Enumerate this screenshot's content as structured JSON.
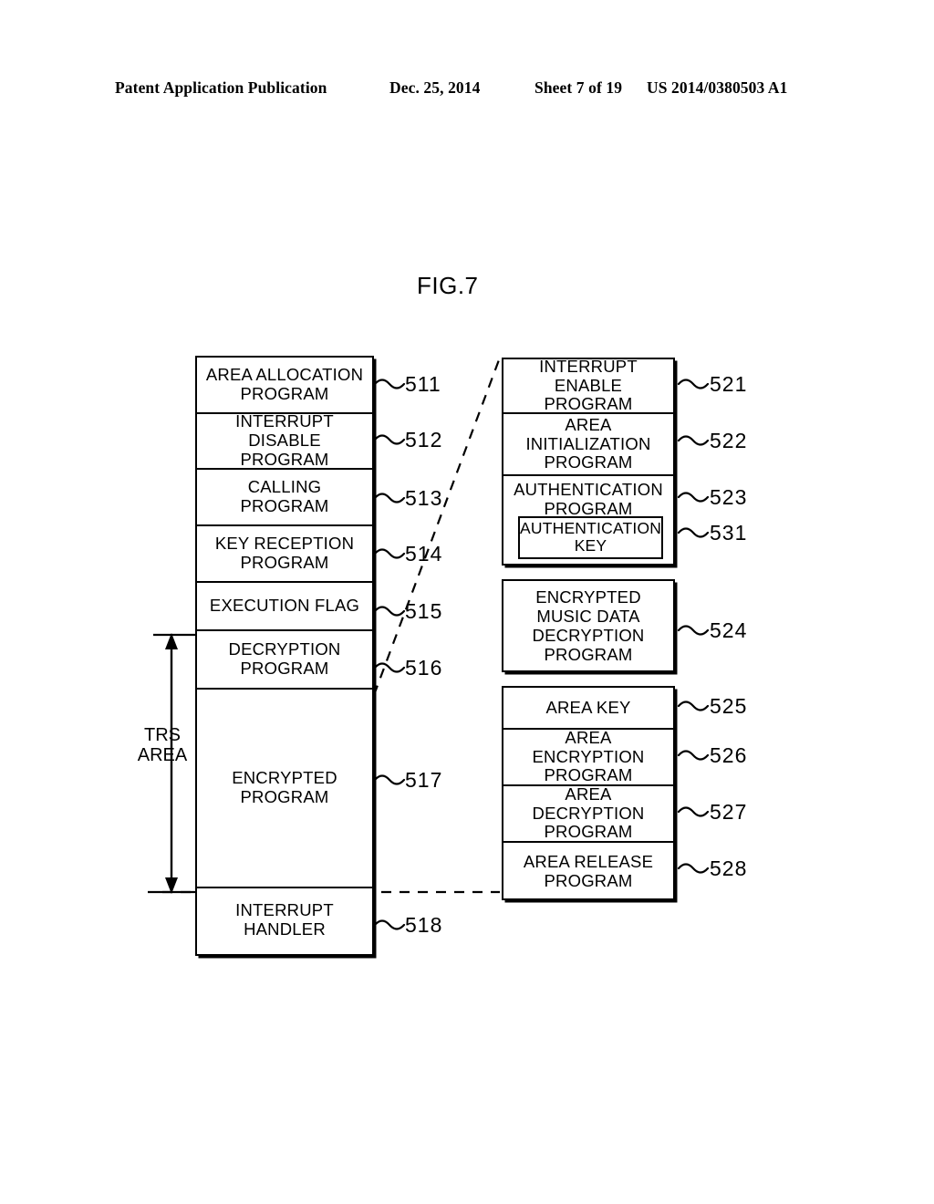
{
  "header": {
    "publication": "Patent Application Publication",
    "date": "Dec. 25, 2014",
    "sheet": "Sheet 7 of 19",
    "patent_number": "US 2014/0380503 A1"
  },
  "figure": {
    "title": "FIG.7",
    "trs_area_label": "TRS\nAREA"
  },
  "left_column": {
    "blocks": [
      {
        "label": "AREA ALLOCATION\nPROGRAM",
        "ref": "511"
      },
      {
        "label": "INTERRUPT DISABLE\nPROGRAM",
        "ref": "512"
      },
      {
        "label": "CALLING PROGRAM",
        "ref": "513"
      },
      {
        "label": "KEY RECEPTION\nPROGRAM",
        "ref": "514"
      },
      {
        "label": "EXECUTION FLAG",
        "ref": "515"
      },
      {
        "label": "DECRYPTION\nPROGRAM",
        "ref": "516"
      },
      {
        "label": "ENCRYPTED\nPROGRAM",
        "ref": "517"
      },
      {
        "label": "INTERRUPT\nHANDLER",
        "ref": "518"
      }
    ]
  },
  "right_column": {
    "group_a": [
      {
        "label": "INTERRUPT ENABLE\nPROGRAM",
        "ref": "521"
      },
      {
        "label": "AREA\nINITIALIZATION\nPROGRAM",
        "ref": "522"
      },
      {
        "label": "AUTHENTICATION\nPROGRAM",
        "ref": "523",
        "inner": {
          "label": "AUTHENTICATION\nKEY",
          "ref": "531"
        }
      }
    ],
    "group_b": [
      {
        "label": "ENCRYPTED\nMUSIC DATA\nDECRYPTION\nPROGRAM",
        "ref": "524"
      }
    ],
    "group_c": [
      {
        "label": "AREA KEY",
        "ref": "525"
      },
      {
        "label": "AREA ENCRYPTION\nPROGRAM",
        "ref": "526"
      },
      {
        "label": "AREA DECRYPTION\nPROGRAM",
        "ref": "527"
      },
      {
        "label": "AREA RELEASE\nPROGRAM",
        "ref": "528"
      }
    ]
  },
  "colors": {
    "ink": "#000000",
    "paper": "#ffffff"
  }
}
